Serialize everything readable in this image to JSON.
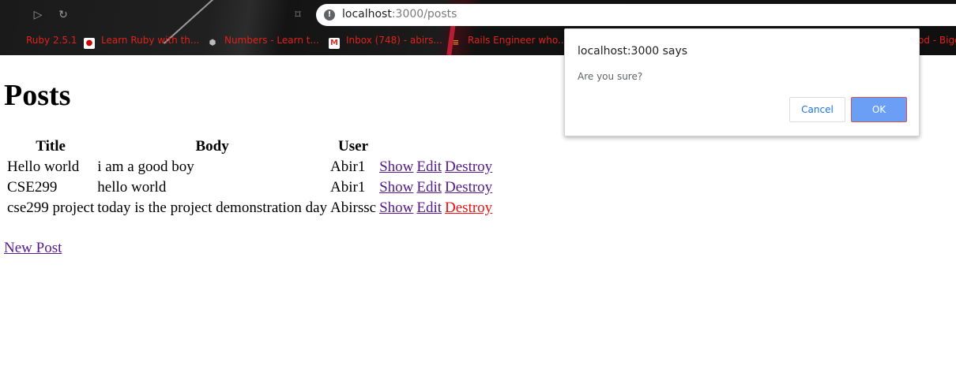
{
  "browser": {
    "url_host": "localhost",
    "url_rest": ":3000/posts",
    "bookmarks": [
      {
        "label": "Ruby 2.5.1",
        "icon": "none"
      },
      {
        "label": "Learn Ruby with th...",
        "icon": "rubymine-icon"
      },
      {
        "label": "Numbers - Learn t...",
        "icon": "hexagon-icon"
      },
      {
        "label": "Inbox (748) - abirs...",
        "icon": "gmail-icon"
      },
      {
        "label": "Rails Engineer who...",
        "icon": "stackoverflow-icon"
      },
      {
        "label": "od - Bigg",
        "icon": "none"
      }
    ]
  },
  "page": {
    "title": "Posts",
    "table": {
      "headers": [
        "Title",
        "Body",
        "User",
        ""
      ],
      "rows": [
        {
          "title": "Hello world",
          "body": "i am a good boy",
          "user": "Abir1",
          "show": "Show",
          "edit": "Edit",
          "destroy": "Destroy"
        },
        {
          "title": "CSE299",
          "body": "hello world",
          "user": "Abir1",
          "show": "Show",
          "edit": "Edit",
          "destroy": "Destroy"
        },
        {
          "title": "cse299 project",
          "body": "today is the project demonstration day",
          "user": "Abirssc",
          "show": "Show",
          "edit": "Edit",
          "destroy": "Destroy"
        }
      ]
    },
    "new_post_label": "New Post"
  },
  "dialog": {
    "origin": "localhost:3000 says",
    "message": "Are you sure?",
    "cancel_label": "Cancel",
    "ok_label": "OK"
  },
  "colors": {
    "link": "#551a8b",
    "active_link": "#ee1111",
    "bookmark_text": "#e2211c",
    "ok_button": "#6a9ff5"
  }
}
